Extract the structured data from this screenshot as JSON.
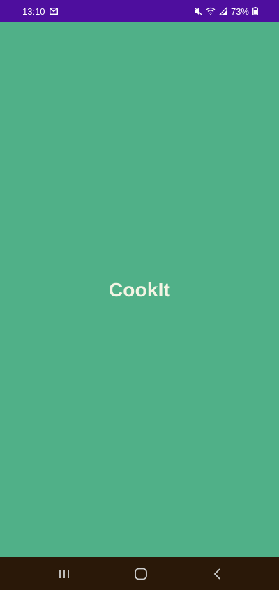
{
  "status_bar": {
    "time": "13:10",
    "battery": "73%",
    "icons": [
      "email-notification-icon",
      "mute-icon",
      "wifi-icon",
      "signal-icon",
      "battery-icon"
    ]
  },
  "main": {
    "app_title": "CookIt"
  },
  "nav_bar": {
    "icons": [
      "recent-apps-icon",
      "home-icon",
      "back-icon"
    ]
  },
  "colors": {
    "status_bar": "#4E0E9E",
    "background": "#50B088",
    "title": "#F4F4E4",
    "nav_bar": "#2A1808"
  }
}
